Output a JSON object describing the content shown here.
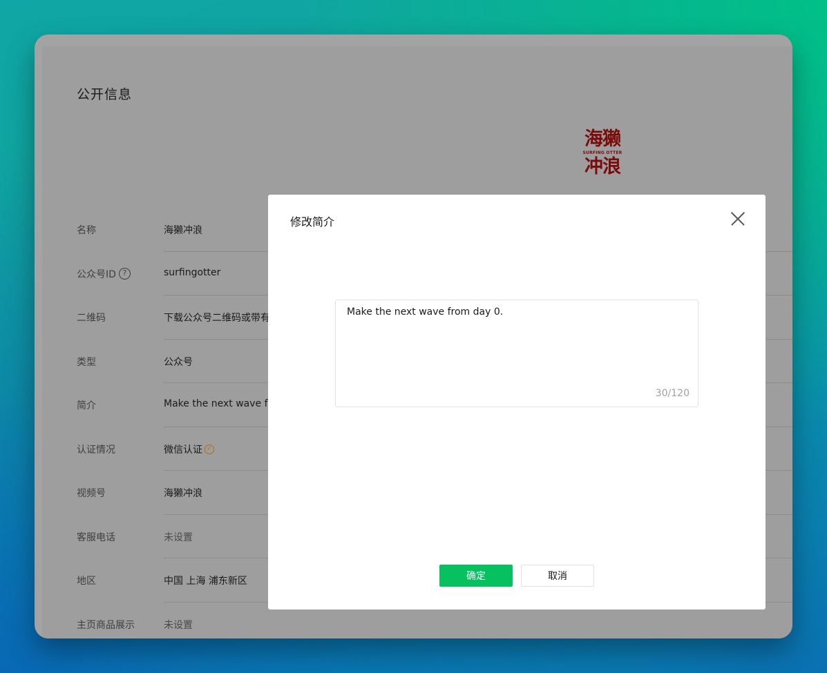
{
  "page": {
    "section_title": "公开信息",
    "logo_text_top": "海獭",
    "logo_text_mid": "SURFING OTTER",
    "logo_text_bottom": "冲浪"
  },
  "info_rows": [
    {
      "label": "名称",
      "value": "海獭冲浪"
    },
    {
      "label": "公众号ID",
      "value": "surfingotter"
    },
    {
      "label": "二维码",
      "value": "下载公众号二维码或带有搜"
    },
    {
      "label": "类型",
      "value": "公众号"
    },
    {
      "label": "简介",
      "value": "Make the next wave from"
    },
    {
      "label": "认证情况",
      "value": "微信认证"
    },
    {
      "label": "视频号",
      "value": "海獭冲浪"
    },
    {
      "label": "客服电话",
      "value": "未设置"
    },
    {
      "label": "地区",
      "value": "中国 上海 浦东新区"
    },
    {
      "label": "主页商品展示",
      "value": "未设置"
    }
  ],
  "dialog": {
    "title": "修改简介",
    "textarea_value": "Make the next wave from day 0.",
    "counter": "30/120",
    "confirm_label": "确定",
    "cancel_label": "取消"
  },
  "icons": {
    "help": "question-circle-icon",
    "verified": "check-circle-icon",
    "close": "close-icon"
  },
  "colors": {
    "primary": "#07c160",
    "logo": "#7a0b0b",
    "verified": "#b66a06"
  }
}
